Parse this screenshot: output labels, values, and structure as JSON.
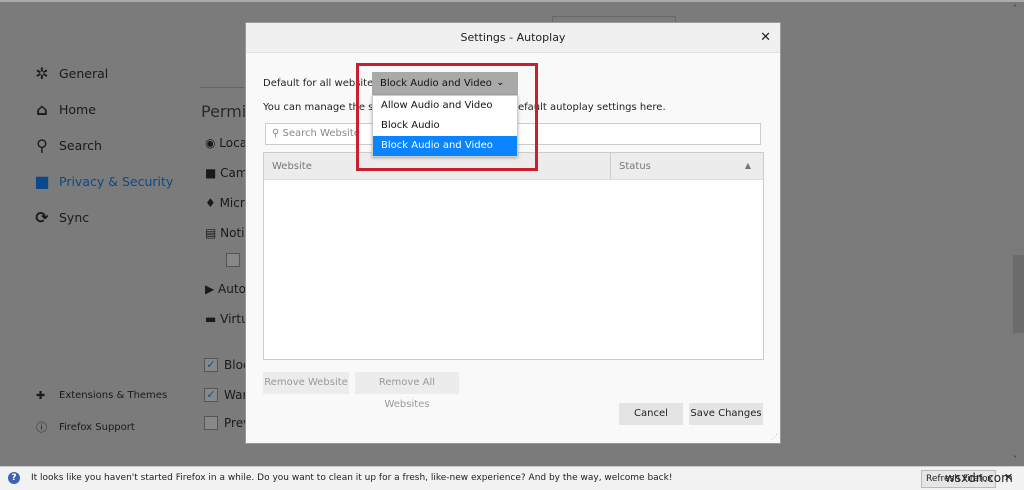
{
  "sidebar": {
    "items": [
      {
        "label": "General",
        "icon": "gear-icon"
      },
      {
        "label": "Home",
        "icon": "home-icon"
      },
      {
        "label": "Search",
        "icon": "search-icon"
      },
      {
        "label": "Privacy & Security",
        "icon": "lock-icon"
      },
      {
        "label": "Sync",
        "icon": "sync-icon"
      }
    ],
    "bottom": [
      {
        "label": "Extensions & Themes",
        "icon": "puzzle-icon"
      },
      {
        "label": "Firefox Support",
        "icon": "help-icon"
      }
    ]
  },
  "background": {
    "section_title": "Permis",
    "perms": [
      "Loca",
      "Cam",
      "Micr",
      "Noti",
      "Auto",
      "Virtu"
    ],
    "checks": [
      "Bloc",
      "War",
      "Prev"
    ]
  },
  "dialog": {
    "title": "Settings - Autoplay",
    "default_label": "Default for all websites:",
    "selected": "Block Audio and Video",
    "options": [
      "Allow Audio and Video",
      "Block Audio",
      "Block Audio and Video"
    ],
    "manage_text": "You can manage the sites that do not follow your default autoplay settings here.",
    "search_placeholder": "Search Website",
    "columns": [
      "Website",
      "Status"
    ],
    "remove_website": "Remove Website",
    "remove_all": "Remove All Websites",
    "cancel": "Cancel",
    "save": "Save Changes"
  },
  "notification": {
    "message": "It looks like you haven't started Firefox in a while. Do you want to clean it up for a fresh, like-new experience? And by the way, welcome back!",
    "button": "Refresh Firefox"
  },
  "watermark": "wsxdn.com",
  "colors": {
    "accent": "#0a84ff",
    "highlight_box": "#c8202e",
    "overlay": "#7b7b7b"
  }
}
